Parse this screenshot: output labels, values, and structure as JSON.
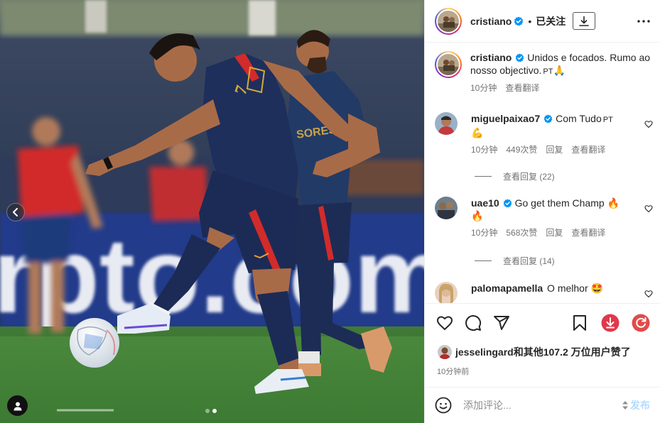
{
  "post": {
    "username": "cristiano",
    "follow_state": "已关注",
    "separator": "•"
  },
  "caption": {
    "username": "cristiano",
    "text": "Unidos e focados. Rumo ao nosso objectivo.",
    "lang_tag": "PT",
    "emoji": "🙏",
    "time": "10分钟",
    "translate": "查看翻译"
  },
  "comments": [
    {
      "username": "miguelpaixao7",
      "text": "Com Tudo",
      "lang_tag": "PT",
      "emoji": "💪",
      "time": "10分钟",
      "likes": "449次赞",
      "reply": "回复",
      "translate": "查看翻译",
      "view_replies": "查看回复 (22)"
    },
    {
      "username": "uae10",
      "text": "Go get them Champ",
      "lang_tag": "",
      "emoji": "🔥",
      "emoji2": "🔥",
      "time": "10分钟",
      "likes": "568次赞",
      "reply": "回复",
      "translate": "查看翻译",
      "view_replies": "查看回复 (14)"
    },
    {
      "username": "palomapamella",
      "text": "O melhor",
      "emoji": "🤩"
    }
  ],
  "likes": {
    "text": "jesselingard和其他107.2 万位用户赞了"
  },
  "time_ago": "10分钟前",
  "composer": {
    "placeholder": "添加评论...",
    "post_label": "发布"
  },
  "media": {
    "carousel_index": 2,
    "carousel_total": 2,
    "jersey_text": "SORES",
    "ad_board_text": "rpto.com"
  },
  "colors": {
    "verified": "#0095f6",
    "download_red": "#e0384b",
    "refresh_red": "#e14b4b",
    "post_button": "#b3dbff"
  }
}
